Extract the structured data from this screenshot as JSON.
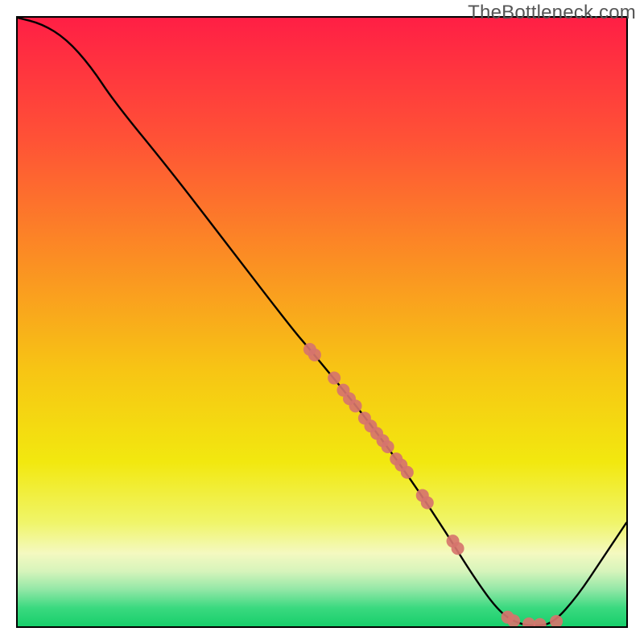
{
  "watermark": "TheBottleneck.com",
  "chart_data": {
    "type": "line",
    "title": "",
    "xlabel": "",
    "ylabel": "",
    "xlim": [
      0,
      100
    ],
    "ylim": [
      0,
      100
    ],
    "curve": {
      "name": "bottleneck-curve",
      "description": "Single black curve starting at top-left, descending to a minimum near x≈82–87 at y≈0, then rising toward bottom-right corner.",
      "points": [
        {
          "x": 0.0,
          "y": 100.0
        },
        {
          "x": 4.0,
          "y": 99.0
        },
        {
          "x": 8.0,
          "y": 96.5
        },
        {
          "x": 12.0,
          "y": 92.0
        },
        {
          "x": 16.0,
          "y": 86.0
        },
        {
          "x": 25.0,
          "y": 75.0
        },
        {
          "x": 35.0,
          "y": 62.0
        },
        {
          "x": 45.0,
          "y": 49.0
        },
        {
          "x": 48.0,
          "y": 45.5
        },
        {
          "x": 55.0,
          "y": 37.0
        },
        {
          "x": 60.0,
          "y": 30.5
        },
        {
          "x": 65.0,
          "y": 23.5
        },
        {
          "x": 70.0,
          "y": 16.0
        },
        {
          "x": 75.0,
          "y": 8.0
        },
        {
          "x": 79.0,
          "y": 2.5
        },
        {
          "x": 82.0,
          "y": 0.5
        },
        {
          "x": 85.0,
          "y": 0.0
        },
        {
          "x": 88.0,
          "y": 0.5
        },
        {
          "x": 92.0,
          "y": 5.0
        },
        {
          "x": 96.0,
          "y": 11.0
        },
        {
          "x": 100.0,
          "y": 17.0
        }
      ]
    },
    "markers": {
      "name": "scatter-points",
      "color": "#d6746c",
      "radius_px": 8,
      "points": [
        {
          "x": 48.0,
          "y": 45.5
        },
        {
          "x": 48.8,
          "y": 44.6
        },
        {
          "x": 52.0,
          "y": 40.8
        },
        {
          "x": 53.5,
          "y": 38.8
        },
        {
          "x": 54.5,
          "y": 37.4
        },
        {
          "x": 55.5,
          "y": 36.2
        },
        {
          "x": 57.0,
          "y": 34.2
        },
        {
          "x": 58.0,
          "y": 32.9
        },
        {
          "x": 59.0,
          "y": 31.7
        },
        {
          "x": 60.0,
          "y": 30.5
        },
        {
          "x": 60.8,
          "y": 29.5
        },
        {
          "x": 62.2,
          "y": 27.5
        },
        {
          "x": 63.0,
          "y": 26.5
        },
        {
          "x": 64.0,
          "y": 25.3
        },
        {
          "x": 66.5,
          "y": 21.5
        },
        {
          "x": 67.3,
          "y": 20.3
        },
        {
          "x": 71.5,
          "y": 14.0
        },
        {
          "x": 72.3,
          "y": 12.8
        },
        {
          "x": 80.5,
          "y": 1.5
        },
        {
          "x": 81.5,
          "y": 0.9
        },
        {
          "x": 84.0,
          "y": 0.4
        },
        {
          "x": 85.8,
          "y": 0.3
        },
        {
          "x": 88.5,
          "y": 0.8
        }
      ]
    },
    "background_gradient": {
      "type": "vertical",
      "stops": [
        {
          "pos": 0.0,
          "color": "#ff1f45"
        },
        {
          "pos": 0.2,
          "color": "#ff5236"
        },
        {
          "pos": 0.4,
          "color": "#fb8f23"
        },
        {
          "pos": 0.58,
          "color": "#f7c514"
        },
        {
          "pos": 0.73,
          "color": "#f2e80f"
        },
        {
          "pos": 0.83,
          "color": "#f0f56a"
        },
        {
          "pos": 0.88,
          "color": "#f4f9c0"
        },
        {
          "pos": 0.91,
          "color": "#d6f4bb"
        },
        {
          "pos": 0.94,
          "color": "#91e7a6"
        },
        {
          "pos": 0.97,
          "color": "#3ad97f"
        },
        {
          "pos": 1.0,
          "color": "#18cf6b"
        }
      ]
    }
  }
}
